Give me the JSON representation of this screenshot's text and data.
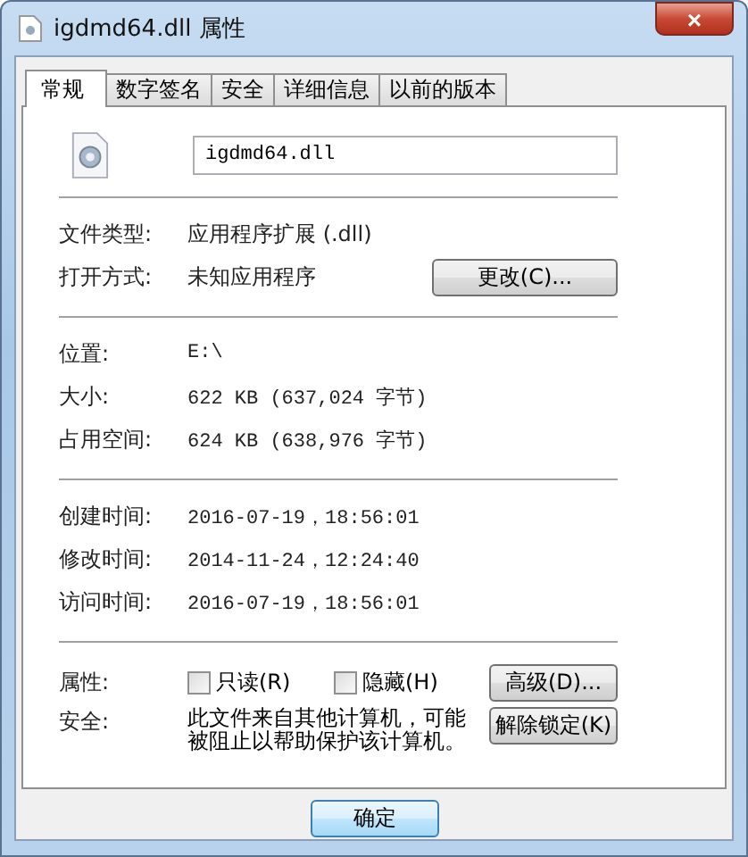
{
  "window": {
    "title": "igdmd64.dll 属性",
    "close": "×"
  },
  "tabs": [
    {
      "label": "常规",
      "selected": true
    },
    {
      "label": "数字签名",
      "selected": false
    },
    {
      "label": "安全",
      "selected": false
    },
    {
      "label": "详细信息",
      "selected": false
    },
    {
      "label": "以前的版本",
      "selected": false
    }
  ],
  "file_name": {
    "value": "igdmd64.dll"
  },
  "type_rows": [
    {
      "label": "文件类型:",
      "value": "应用程序扩展 (.dll)"
    },
    {
      "label": "打开方式:",
      "value": "未知应用程序",
      "button": "更改(C)..."
    }
  ],
  "size_rows": [
    {
      "label": "位置:",
      "value": "E:\\"
    },
    {
      "label": "大小:",
      "value": "622 KB (637,024 字节)"
    },
    {
      "label": "占用空间:",
      "value": "624 KB (638,976 字节)"
    }
  ],
  "time_rows": [
    {
      "label": "创建时间:",
      "value": "2016-07-19，18:56:01"
    },
    {
      "label": "修改时间:",
      "value": "2014-11-24，12:24:40"
    },
    {
      "label": "访问时间:",
      "value": "2016-07-19，18:56:01"
    }
  ],
  "attributes": {
    "label": "属性:",
    "checkboxes": [
      {
        "label": "只读(R)",
        "checked": false
      },
      {
        "label": "隐藏(H)",
        "checked": false
      }
    ],
    "button": "高级(D)..."
  },
  "security": {
    "label": "安全:",
    "text": "此文件来自其他计算机，可能被阻止以帮助保护该计算机。",
    "button": "解除锁定(K)"
  },
  "footer_buttons": [
    "确定"
  ]
}
